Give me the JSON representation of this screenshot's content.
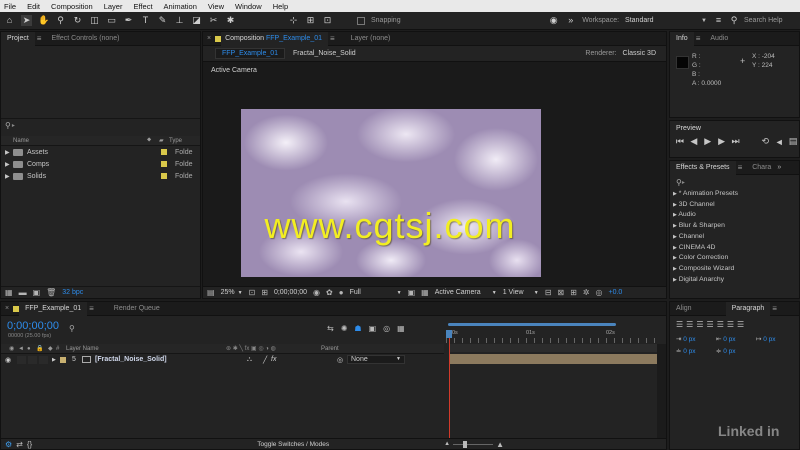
{
  "menu": [
    "File",
    "Edit",
    "Composition",
    "Layer",
    "Effect",
    "Animation",
    "View",
    "Window",
    "Help"
  ],
  "toolbar": {
    "tools": [
      "home-icon",
      "hand-icon",
      "zoom-icon",
      "rotate-icon",
      "camera-icon",
      "rect-icon",
      "pen-icon",
      "text-icon",
      "brush-icon",
      "stamp-icon",
      "eraser-icon",
      "roto-icon",
      "pin-icon"
    ],
    "snapping": "Snapping",
    "workspace_label": "Workspace:",
    "workspace_value": "Standard",
    "search_help": "Search Help"
  },
  "project_panel": {
    "tab_project": "Project",
    "tab_effect_controls": "Effect Controls (none)",
    "col_name": "Name",
    "col_type": "Type",
    "items": [
      {
        "name": "Assets",
        "type": "Folde"
      },
      {
        "name": "Comps",
        "type": "Folde"
      },
      {
        "name": "Solids",
        "type": "Folde"
      }
    ],
    "bpc": "32 bpc"
  },
  "comp_panel": {
    "tab_prefix": "Composition",
    "tab_name": "FFP_Example_01",
    "tab_layer": "Layer (none)",
    "sub_tab_active": "FFP_Example_01",
    "sub_tab_other": "Fractal_Noise_Solid",
    "renderer_label": "Renderer:",
    "renderer_value": "Classic 3D",
    "active_camera": "Active Camera",
    "watermark": "www.cgtsj.com",
    "bottom": {
      "zoom": "25%",
      "timecode": "0;00;00;00",
      "resolution": "Full",
      "camera": "Active Camera",
      "views": "1 View",
      "exposure": "+0.0"
    }
  },
  "info_panel": {
    "tab_info": "Info",
    "tab_audio": "Audio",
    "r": "R :",
    "g": "G :",
    "b": "B :",
    "a": "A : 0.0000",
    "x": "X : -204",
    "y": "Y : 224"
  },
  "preview_panel": {
    "title": "Preview"
  },
  "effects_panel": {
    "tab_effects": "Effects & Presets",
    "tab_char": "Chara",
    "items": [
      "* Animation Presets",
      "3D Channel",
      "Audio",
      "Blur & Sharpen",
      "Channel",
      "CINEMA 4D",
      "Color Correction",
      "Composite Wizard",
      "Digital Anarchy"
    ]
  },
  "align_panel": {
    "tab_align": "Align",
    "tab_paragraph": "Paragraph",
    "px_values": [
      "0 px",
      "0 px",
      "0 px",
      "0 px",
      "0 px"
    ]
  },
  "timeline": {
    "tab_comp": "FFP_Example_01",
    "tab_render": "Render Queue",
    "timecode": "0;00;00;00",
    "fps": "00000 (25.00 fps)",
    "col_layer_name": "Layer Name",
    "col_parent": "Parent",
    "layer_index": "5",
    "layer_name": "[Fractal_Noise_Solid]",
    "parent_value": "None",
    "ruler": [
      "0s",
      "01s",
      "02s"
    ],
    "toggle": "Toggle Switches / Modes"
  },
  "brand": "Linked in"
}
